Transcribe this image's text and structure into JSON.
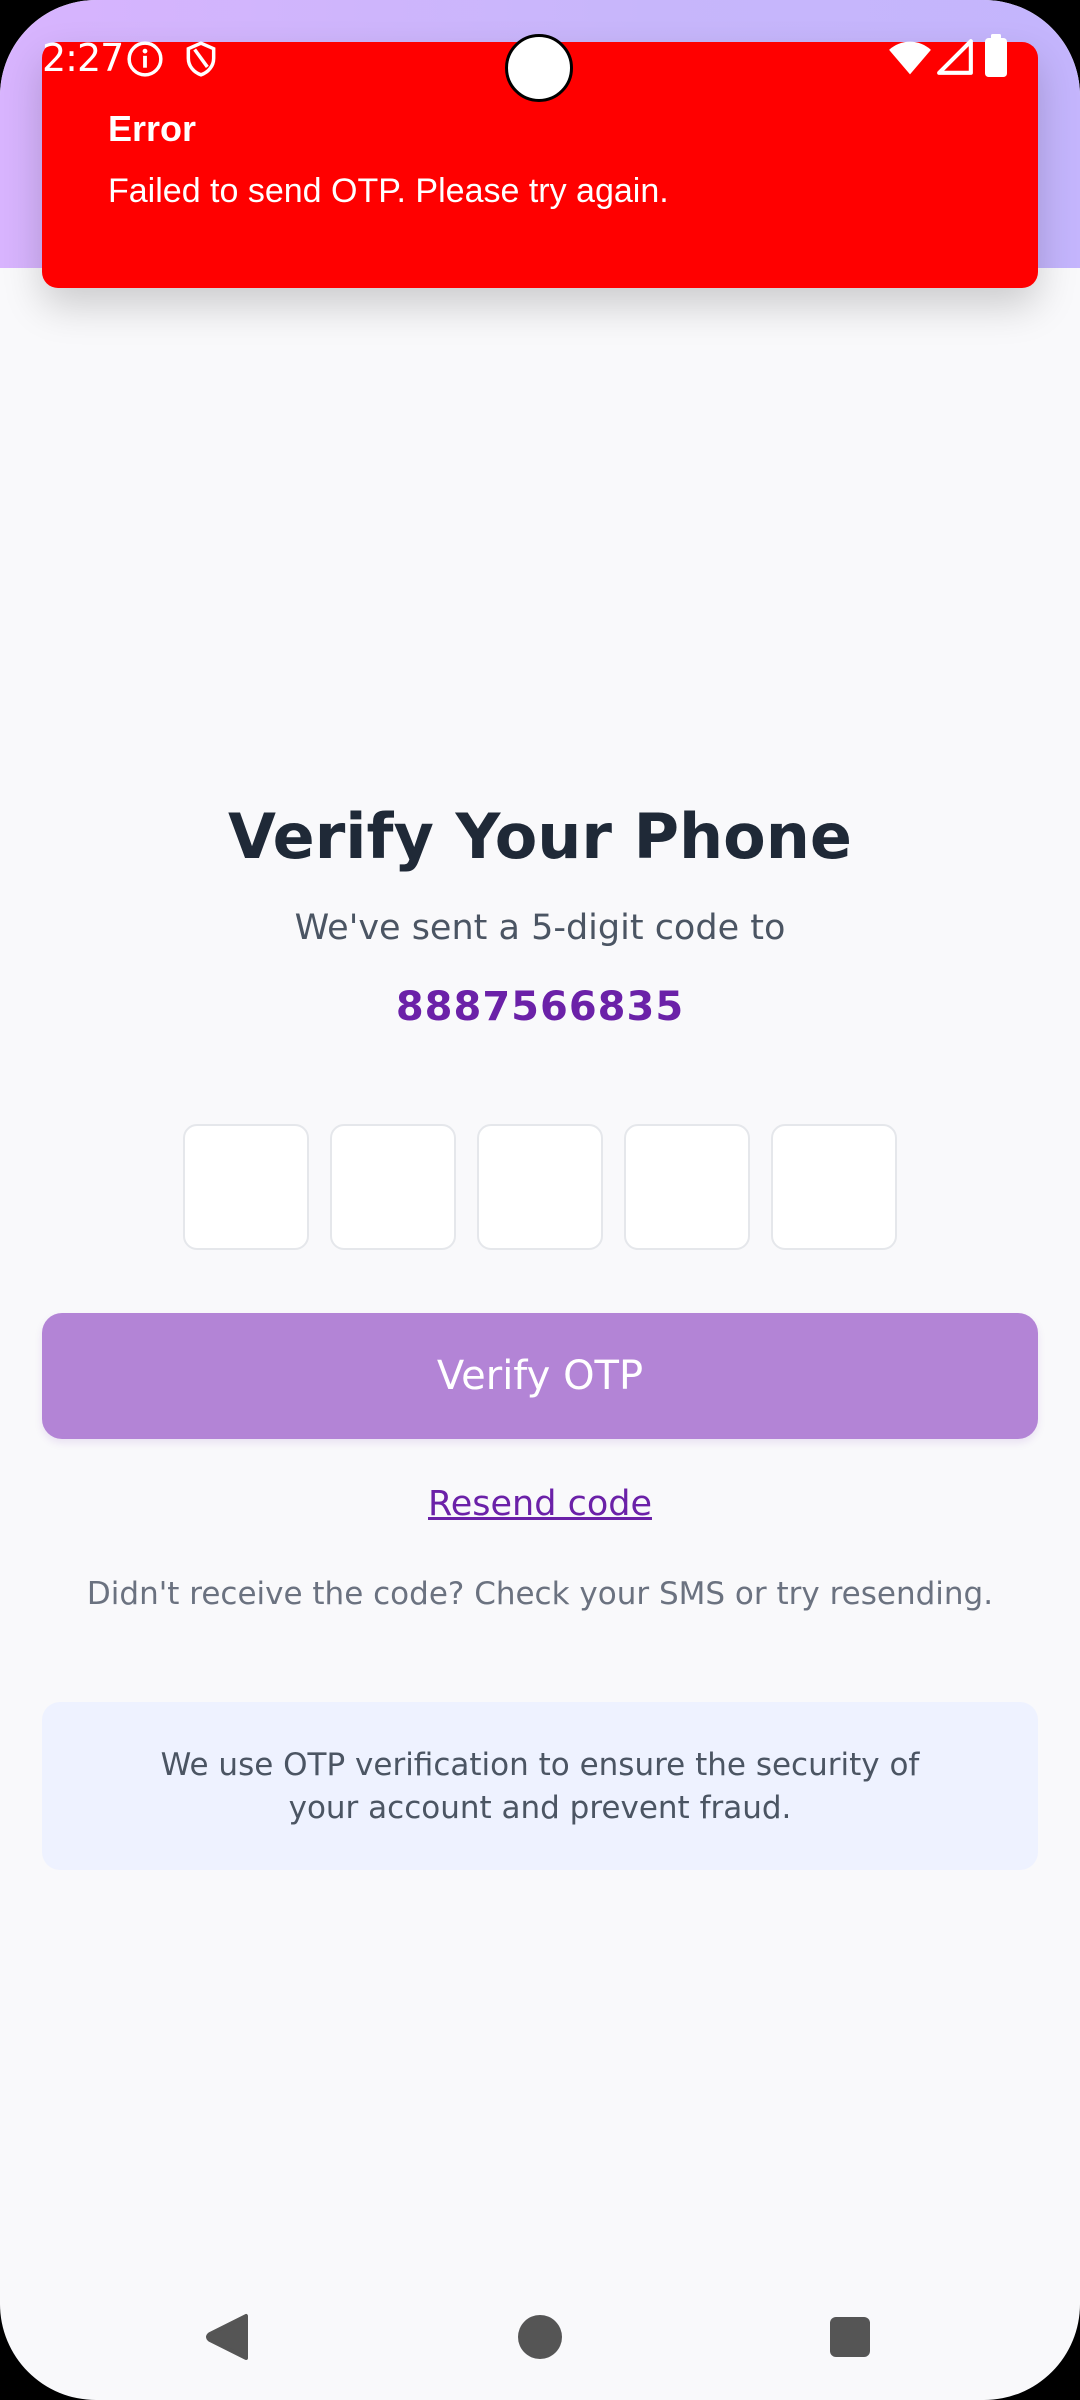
{
  "status_bar": {
    "time": "2:27",
    "icons": [
      "info-icon",
      "shield-icon",
      "wifi-icon",
      "signal-icon",
      "battery-icon"
    ]
  },
  "toast": {
    "title": "Error",
    "message": "Failed to send OTP. Please try again.",
    "color": "#ff0000"
  },
  "verify": {
    "title": "Verify Your Phone",
    "subtitle": "We've sent a 5-digit code to",
    "phone_number": "8887566835",
    "otp_digits": [
      "",
      "",
      "",
      "",
      ""
    ],
    "verify_button_label": "Verify OTP",
    "resend_label": "Resend code",
    "hint": "Didn't receive the code? Check your SMS or try resending.",
    "info": "We use OTP verification to ensure the security of your account and prevent fraud."
  },
  "colors": {
    "accent": "#6b21a8",
    "button": "#b384d6",
    "header": "#c4b5fd"
  },
  "nav": {
    "icons": [
      "back-icon",
      "home-icon",
      "recents-icon"
    ]
  }
}
